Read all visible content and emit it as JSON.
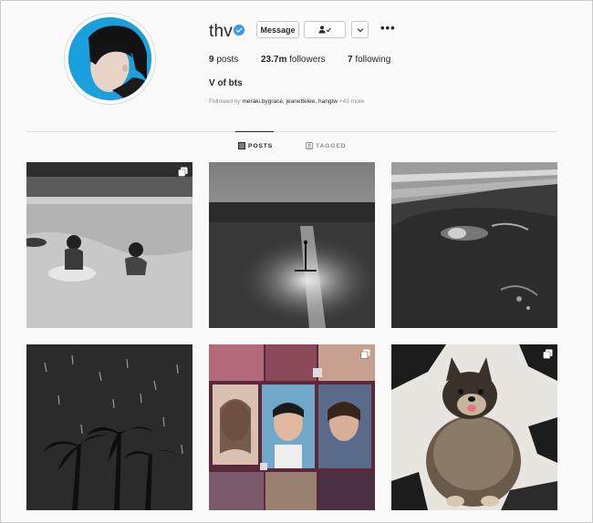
{
  "profile": {
    "username": "thv",
    "verified": true,
    "buttons": {
      "message": "Message"
    },
    "stats": {
      "posts_count": "9",
      "posts_label": " posts",
      "followers_count": "23.7m",
      "followers_label": " followers",
      "following_count": "7",
      "following_label": " following"
    },
    "bio_name": "V of bts",
    "followed_by": {
      "prefix": "Followed by ",
      "names": "meraki.bygrace,  jeanettelee, hangtw",
      "more": " +43 more"
    }
  },
  "tabs": [
    {
      "label": "POSTS",
      "active": true
    },
    {
      "label": "TAGGED",
      "active": false
    }
  ],
  "colors": {
    "accent_verified": "#3897f0",
    "avatar_background": "#1aa0dd"
  },
  "posts": [
    {
      "id": "post-1",
      "multi": true
    },
    {
      "id": "post-2",
      "multi": false
    },
    {
      "id": "post-3",
      "multi": false
    },
    {
      "id": "post-4",
      "multi": false
    },
    {
      "id": "post-5",
      "multi": true
    },
    {
      "id": "post-6",
      "multi": true
    }
  ]
}
